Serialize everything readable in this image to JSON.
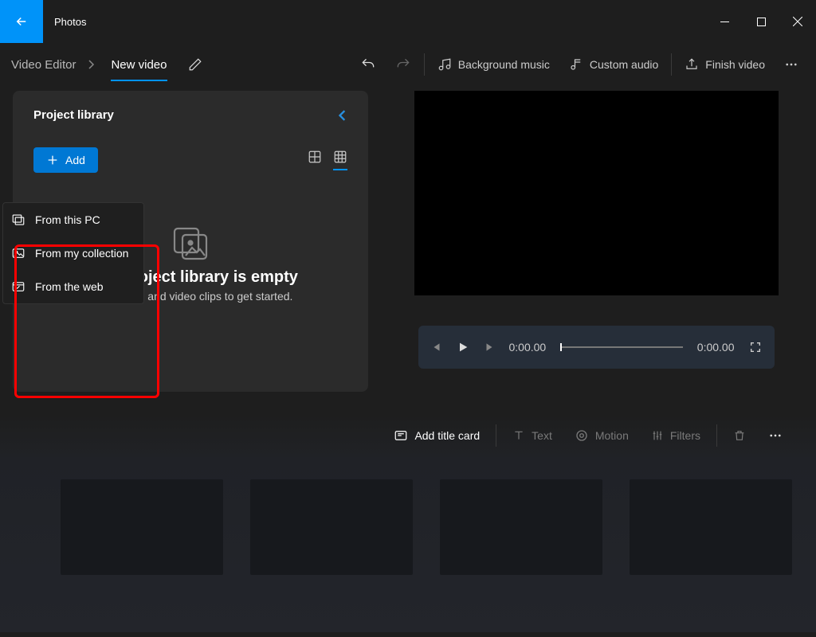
{
  "app": {
    "title": "Photos"
  },
  "breadcrumb": {
    "root": "Video Editor",
    "current": "New video"
  },
  "toolbar": {
    "bg_music": "Background music",
    "custom_audio": "Custom audio",
    "finish": "Finish video"
  },
  "library": {
    "title": "Project library",
    "add_label": "Add",
    "empty_heading": "Your project library is empty",
    "empty_sub": "Add photos and video clips to get started.",
    "menu": {
      "from_pc": "From this PC",
      "from_collection": "From my collection",
      "from_web": "From the web"
    }
  },
  "player": {
    "current_time": "0:00.00",
    "total_time": "0:00.00"
  },
  "storyboard": {
    "add_title_card": "Add title card",
    "text": "Text",
    "motion": "Motion",
    "filters": "Filters"
  }
}
